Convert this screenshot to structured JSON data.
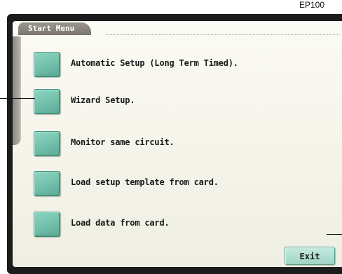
{
  "document": {
    "ref_label": "EP100"
  },
  "screen": {
    "title": "Start Menu",
    "colors": {
      "button_face": "#7cc8b4",
      "screen_bg": "#f7f7ef",
      "tab_bg": "#8a857d",
      "frame": "#1c1c1c"
    },
    "menu_items": [
      {
        "label": "Automatic Setup (Long Term Timed).",
        "icon": "square-button-icon"
      },
      {
        "label": "Wizard Setup.",
        "icon": "square-button-icon"
      },
      {
        "label": "Monitor same circuit.",
        "icon": "square-button-icon"
      },
      {
        "label": "Load setup template from card.",
        "icon": "square-button-icon"
      },
      {
        "label": "Load data from card.",
        "icon": "square-button-icon"
      }
    ],
    "exit_label": "Exit"
  }
}
